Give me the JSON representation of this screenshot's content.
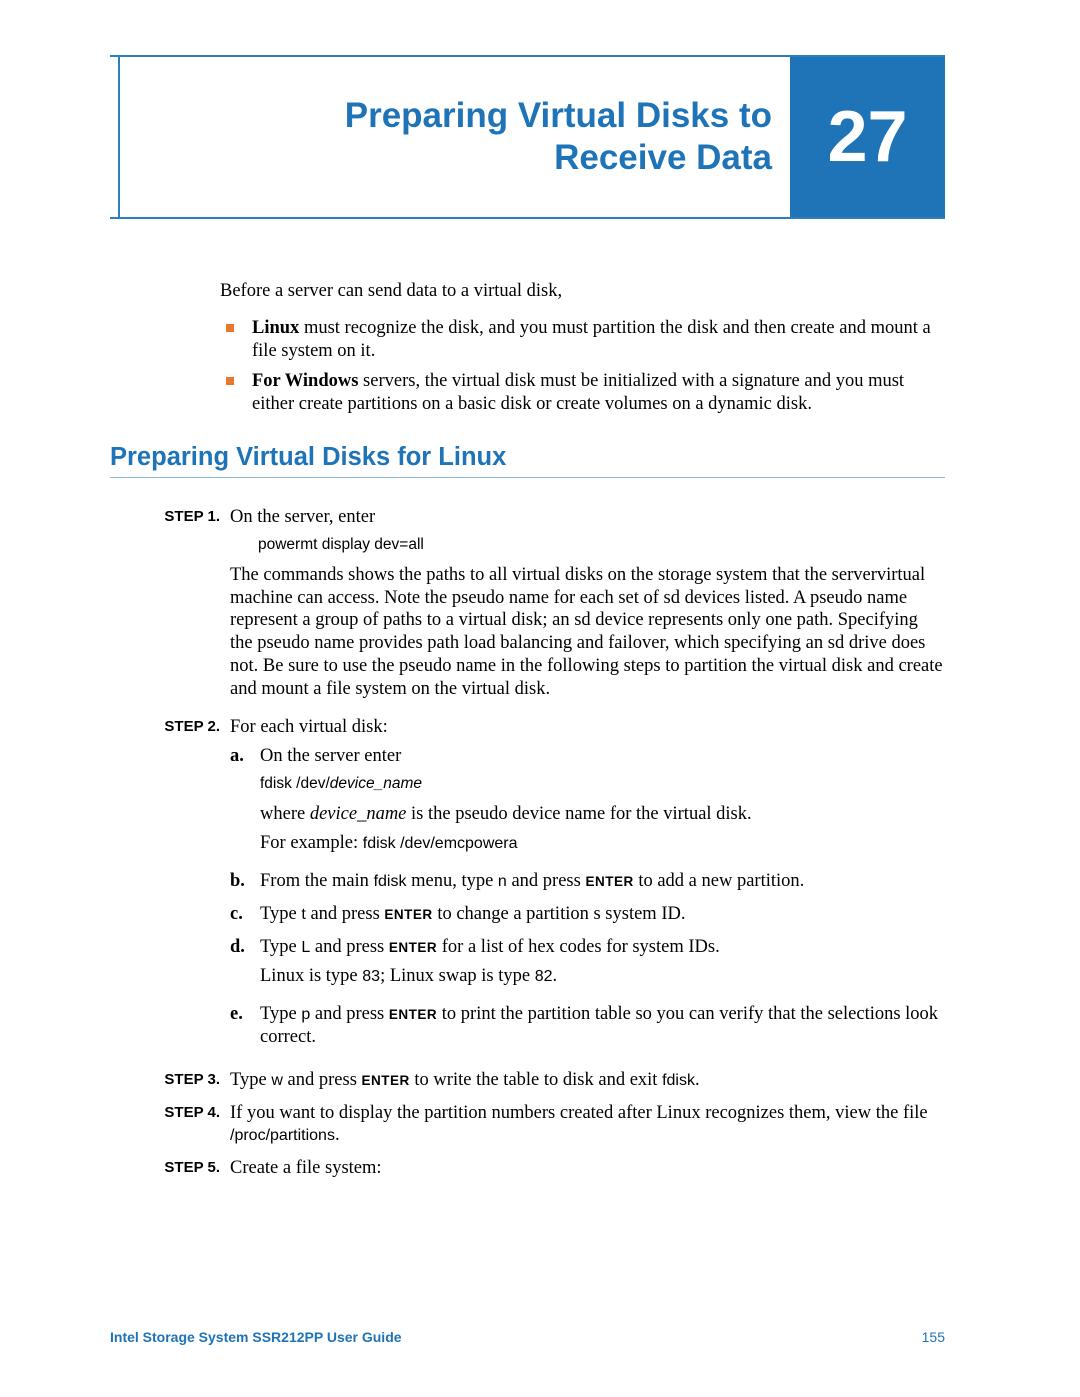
{
  "header": {
    "title_line1": "Preparing Virtual Disks to",
    "title_line2": "Receive Data",
    "chapter_number": "27"
  },
  "intro": "Before a server can send data to a virtual disk,",
  "bullets": {
    "linux_bold": "Linux",
    "linux_rest": " must recognize the disk, and you must partition the disk and then create and mount a file system on it.",
    "windows_bold": "For Windows",
    "windows_rest": " servers, the virtual disk must be initialized with a signature and you must either create partitions on a basic disk or create volumes on a dynamic disk."
  },
  "section_heading": "Preparing Virtual Disks for Linux",
  "steps": {
    "labels": {
      "s1": "STEP 1.",
      "s2": "STEP 2.",
      "s3": "STEP 3.",
      "s4": "STEP 4.",
      "s5": "STEP 5."
    },
    "s1": {
      "line": "On the server, enter",
      "cmd": "powermt display dev=all",
      "para": "The commands shows the paths to all virtual disks on the storage system that the servervirtual machine can access. Note the pseudo name for each set of sd devices listed. A pseudo name represent a group of paths to a virtual disk; an sd device represents only one path. Specifying the pseudo name provides path load balancing and failover, which specifying an sd drive does not. Be sure to use the pseudo name in the following steps to partition the virtual disk and create and mount a file system on the virtual disk."
    },
    "s2": {
      "intro": "For each virtual disk:",
      "a": {
        "label": "a.",
        "line": "On the server enter",
        "cmd_prefix": "fdisk /dev/",
        "cmd_var": "device_name",
        "where_pre": "where ",
        "where_var": "device_name",
        "where_post": " is the pseudo device name for the virtual disk.",
        "example_pre": "For example: ",
        "example_cmd": "fdisk /dev/emcpowera"
      },
      "b": {
        "label": "b.",
        "pre1": "From the main ",
        "mono1": "fdisk",
        "mid1": " menu, type ",
        "mono2": "n",
        "mid2": " and press ",
        "enter": "ENTER",
        "post": " to add a new partition."
      },
      "c": {
        "label": "c.",
        "pre": "Type ",
        "mono": "t",
        "mid": " and press ",
        "enter": "ENTER",
        "post": " to change a partition s system ID."
      },
      "d": {
        "label": "d.",
        "pre": "Type ",
        "mono": "L",
        "mid": " and press ",
        "enter": "ENTER",
        "post": " for a list of hex codes for system IDs.",
        "note_pre": "Linux is type ",
        "note_83": "83",
        "note_mid": "; Linux swap is type ",
        "note_82": "82",
        "note_end": "."
      },
      "e": {
        "label": "e.",
        "pre": "Type ",
        "mono": "p",
        "mid": " and press ",
        "enter": "ENTER",
        "post": " to print the partition table so you can verify that the selections look correct."
      }
    },
    "s3": {
      "pre": "Type ",
      "mono1": "w",
      "mid": " and press ",
      "enter": "ENTER",
      "mid2": " to write the table to disk and exit ",
      "mono2": "fdisk",
      "end": "."
    },
    "s4": {
      "pre": "If you want to display the partition numbers created after Linux recognizes them, view the file ",
      "mono": "/proc/partitions",
      "end": "."
    },
    "s5": {
      "text": "Create a file system:"
    }
  },
  "footer": {
    "guide": "Intel Storage System SSR212PP User Guide",
    "page": "155"
  }
}
